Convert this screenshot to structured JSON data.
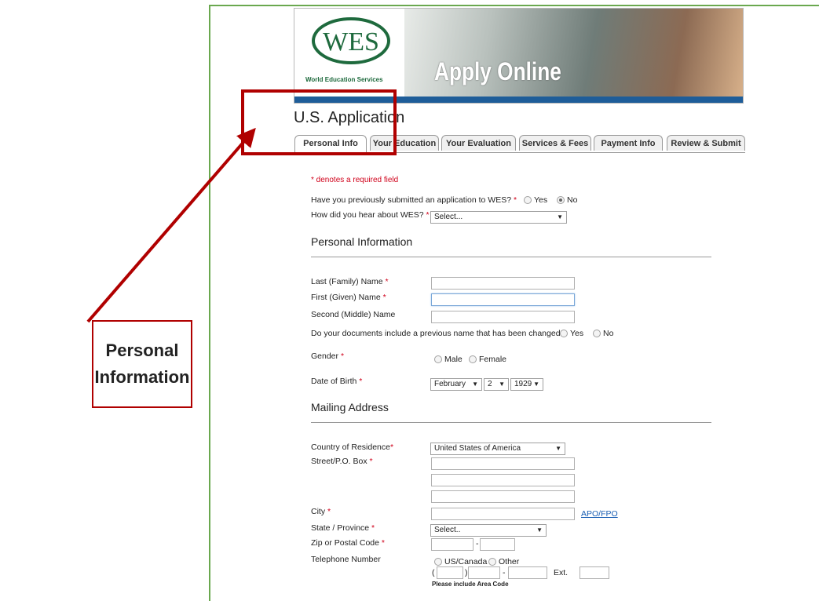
{
  "banner": {
    "logo_text": "WES",
    "logo_subtitle": "World Education Services",
    "apply_text": "Apply Online"
  },
  "page_title": "U.S. Application",
  "tabs": [
    {
      "label": "Personal Info",
      "active": true
    },
    {
      "label": "Your Education",
      "active": false
    },
    {
      "label": "Your Evaluation",
      "active": false
    },
    {
      "label": "Services & Fees",
      "active": false
    },
    {
      "label": "Payment Info",
      "active": false
    },
    {
      "label": "Review & Submit",
      "active": false
    }
  ],
  "form": {
    "required_note": "* denotes a required field",
    "previous_app_q": "Have you previously submitted an application to WES?",
    "yes": "Yes",
    "no": "No",
    "hear_q": "How did you hear about WES?",
    "hear_value": "Select...",
    "personal_heading": "Personal Information",
    "last_name": "Last (Family) Name",
    "first_name": "First (Given) Name",
    "middle_name": "Second (Middle) Name",
    "prev_name_q": "Do your documents include a previous name that has been changed?",
    "gender": "Gender",
    "male": "Male",
    "female": "Female",
    "dob": "Date of Birth",
    "dob_month": "February",
    "dob_day": "2",
    "dob_year": "1929",
    "mailing_heading": "Mailing Address",
    "country": "Country of Residence",
    "country_value": "United States of America",
    "street": "Street/P.O. Box",
    "city": "City",
    "apo_link": "APO/FPO",
    "state": "State / Province",
    "state_value": "Select..",
    "zip": "Zip or Postal Code",
    "phone": "Telephone Number",
    "us_canada": "US/Canada",
    "other": "Other",
    "ext": "Ext.",
    "area_code_note": "Please include Area Code",
    "star": "*",
    "dash": "-",
    "paren_open": "(",
    "paren_close": ")"
  },
  "annotation": {
    "callout_line1": "Personal",
    "callout_line2": "Information"
  },
  "colors": {
    "accent_red": "#b00000",
    "banner_blue": "#1e5d99",
    "frame_green": "#6aa84f",
    "logo_green": "#1e6a3d",
    "required_red": "#d0021b"
  }
}
